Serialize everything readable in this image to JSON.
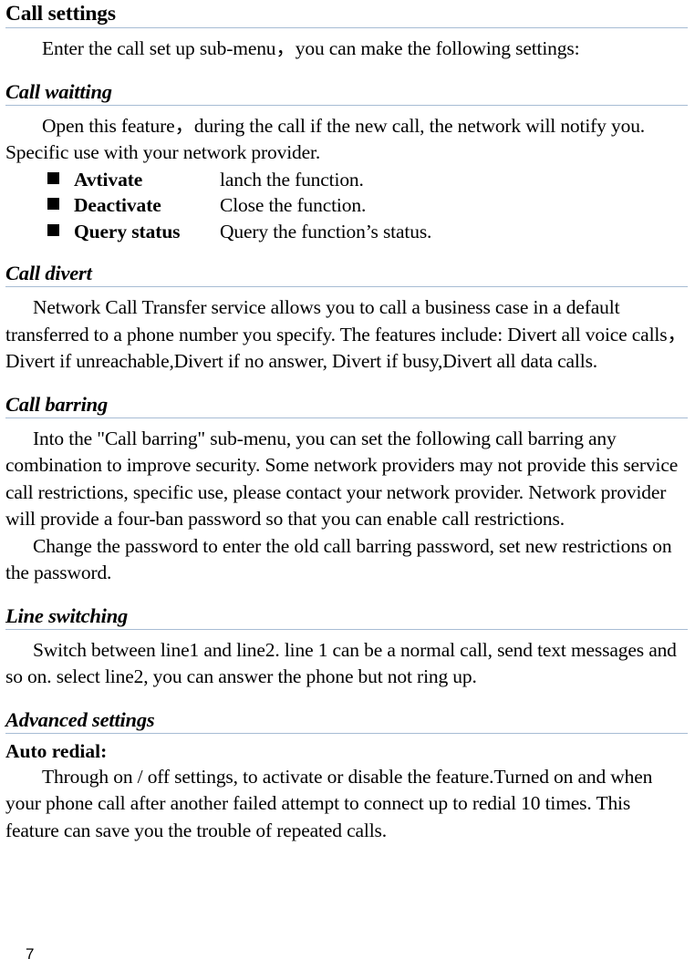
{
  "document": {
    "page_number": "7",
    "rule_color": "#a7bcd4"
  },
  "sections": {
    "call_settings": {
      "heading": "Call settings",
      "intro": "Enter the call set up sub-menu，you can make the following settings:"
    },
    "call_waiting": {
      "heading": "Call waitting",
      "body": "Open this feature，during the call if the new call, the network will notify you. Specific use with your network provider.",
      "options": [
        {
          "term": "Avtivate",
          "description": "lanch the function."
        },
        {
          "term": "Deactivate",
          "description": "Close the function."
        },
        {
          "term": "Query status",
          "description": "Query the function’s status."
        }
      ]
    },
    "call_divert": {
      "heading": "Call divert",
      "body": "Network Call Transfer service allows you to call a business case in a default transferred to a phone number you specify. The features include: Divert all voice calls，Divert if unreachable,Divert if no answer, Divert if busy,Divert all data calls."
    },
    "call_barring": {
      "heading": "Call barring",
      "body_1": "Into the \"Call barring\" sub-menu, you can set the following call barring any combination to improve security. Some network providers may not provide this service call restrictions, specific use, please contact your network provider. Network provider will provide a four-ban password so that you can enable call restrictions.",
      "body_2": "Change the password to enter the old call barring password, set new restrictions on the password."
    },
    "line_switching": {
      "heading": "Line switching",
      "body": "Switch between line1 and line2. line 1 can be a normal call, send text messages and so on. select line2, you can answer the phone but not ring up."
    },
    "advanced_settings": {
      "heading": "Advanced settings",
      "auto_redial": {
        "heading": "Auto redial:",
        "body": "Through on / off settings, to activate or disable the feature.Turned on and when your phone call after another failed attempt to connect up to redial 10 times. This feature can save you the trouble of repeated calls."
      }
    }
  }
}
